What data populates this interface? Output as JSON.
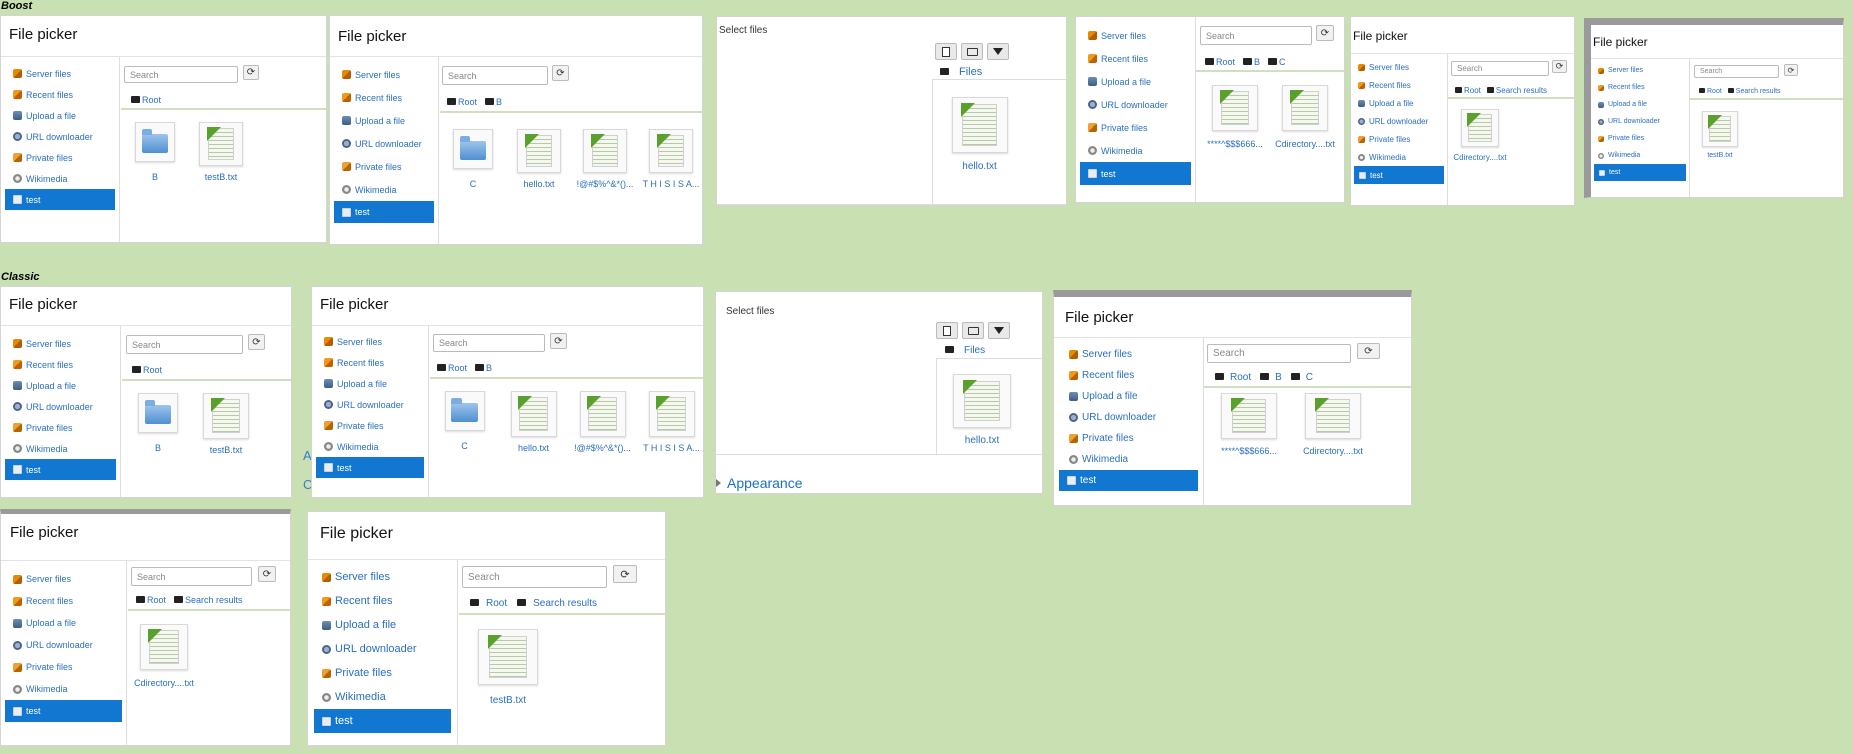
{
  "sections": {
    "boost": "Boost",
    "classic": "Classic"
  },
  "title": "File picker",
  "select_files": "Select files",
  "search_placeholder": "Search",
  "sidebar": [
    "Server files",
    "Recent files",
    "Upload a file",
    "URL downloader",
    "Private files",
    "Wikimedia",
    "test"
  ],
  "crumbs": {
    "root": "Root",
    "b": "B",
    "c": "C",
    "search_results": "Search results",
    "files": "Files"
  },
  "files": {
    "b": "B",
    "c": "C",
    "testB": "testB.txt",
    "hello": "hello.txt",
    "special": "!@#$%^&*()...",
    "thisisa": "T H I S I S A...",
    "stars": "****^$$$666...",
    "cdirectory": "Cdirectory....txt"
  },
  "appearance": "Appearance",
  "colors": {
    "background": "#c8e0b2",
    "active": "#1177d1",
    "link": "#2a6fbf"
  }
}
